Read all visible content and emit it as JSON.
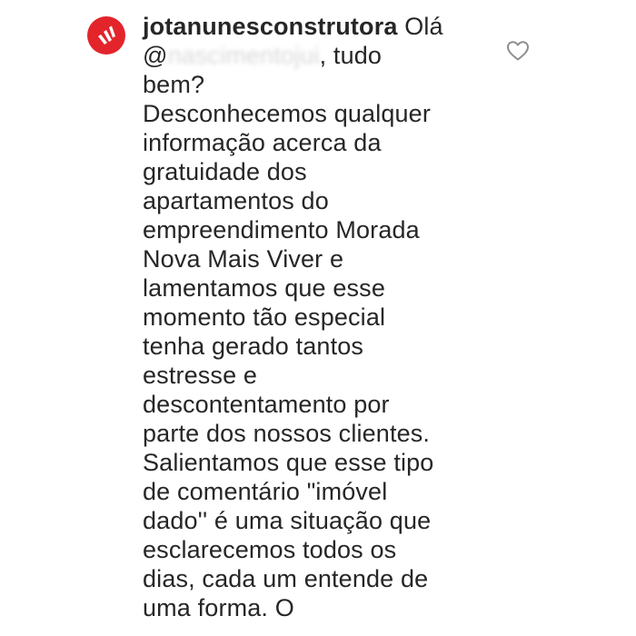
{
  "comment": {
    "username": "jotanunesconstrutora",
    "greeting": "Olá",
    "mention_prefix": "@",
    "mention_redacted": "nascimentojui",
    "greeting_end": ", tudo\nbem?",
    "body": "Desconhecemos qualquer\ninformação acerca da\ngratuidade dos\napartamentos do\nempreendimento Morada\nNova Mais Viver e\nlamentamos que esse\nmomento tão especial\ntenha gerado tantos\nestresse e\ndescontentamento por\nparte dos nossos clientes.\nSalientamos que esse tipo\nde comentário \"imóvel\ndado'' é uma situação que\nesclarecemos todos os\ndias, cada um entende de\numa forma. O"
  },
  "icons": {
    "avatar": "brand-logo-icon",
    "like": "heart-outline-icon"
  },
  "colors": {
    "avatar_background": "#e3242b",
    "text": "#262626",
    "icon_stroke": "#8e8e8e",
    "background": "#ffffff"
  }
}
